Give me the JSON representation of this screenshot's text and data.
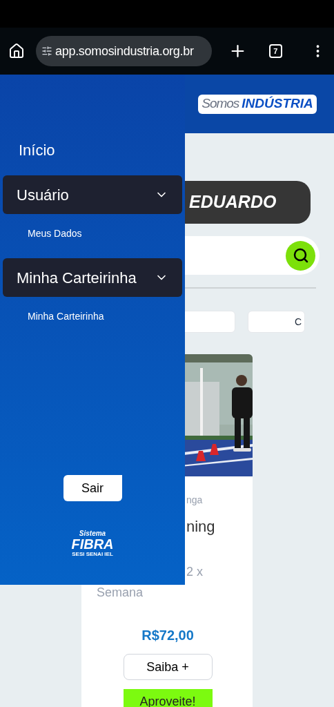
{
  "browser": {
    "url": "app.somosindustria.org.br",
    "tab_count": "7"
  },
  "header": {
    "logo_light": "Somos",
    "logo_bold": "INDÚSTRIA"
  },
  "greeting": "EDUARDO",
  "filters": [
    {
      "kind": "blank"
    },
    {
      "kind": "text",
      "text": "C"
    }
  ],
  "card": {
    "kind": "picture",
    "category": "nga",
    "title": "ning",
    "schedule": [
      "2 x",
      "Semana"
    ],
    "price": "R$72,00",
    "details_button": "Saiba +",
    "offer_button": "Aproveite!"
  },
  "drawer": {
    "items": [
      {
        "kind": "link",
        "label": "Início"
      },
      {
        "kind": "group",
        "label": "Usuário",
        "expanded": true,
        "children": [
          {
            "label": "Meus Dados"
          }
        ]
      },
      {
        "kind": "group",
        "label": "Minha Carteirinha",
        "expanded": true,
        "children": [
          {
            "label": "Minha Carteirinha"
          }
        ]
      }
    ],
    "logout": "Sair",
    "logo": {
      "top": "Sistema",
      "main": "FIBRA",
      "bottom": "SESI SENAI IEL"
    }
  }
}
